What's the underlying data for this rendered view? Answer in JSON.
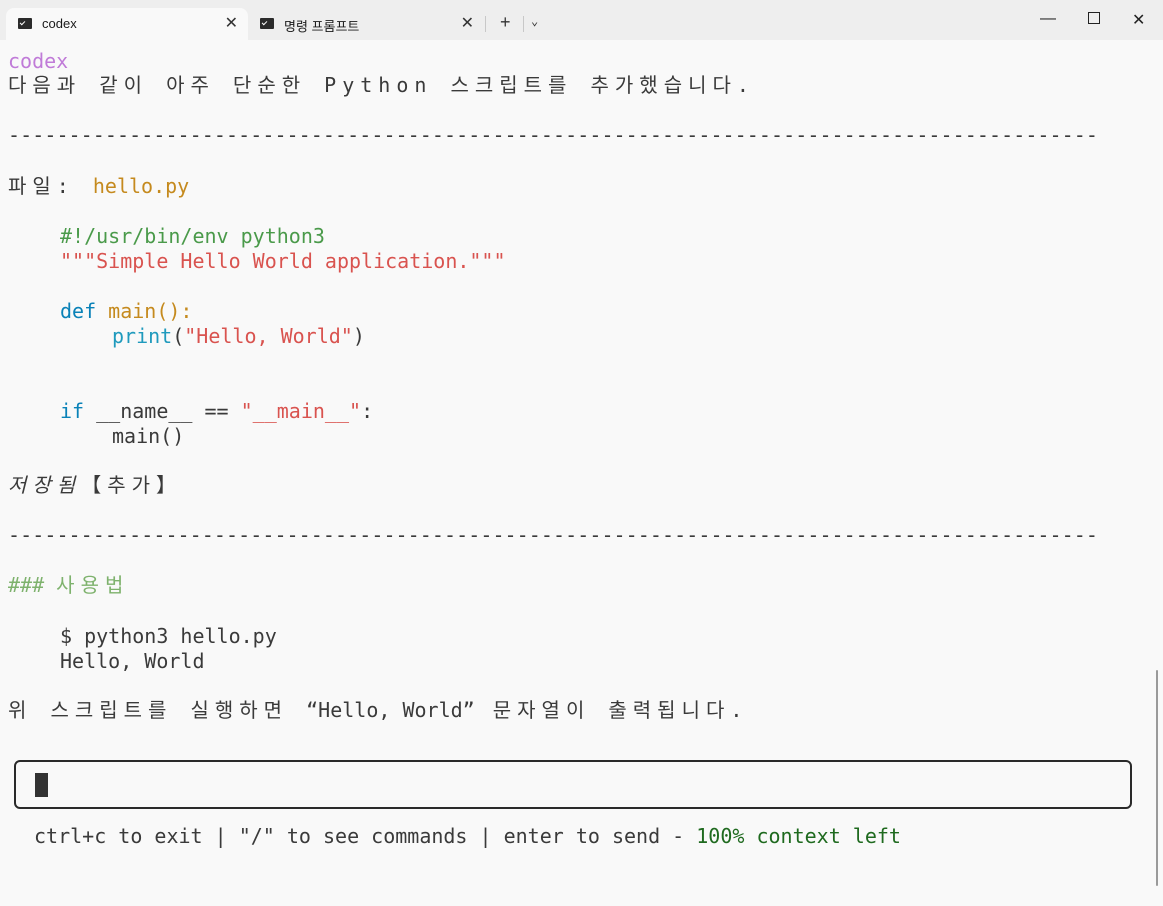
{
  "window": {
    "tabs": [
      {
        "label": "codex",
        "active": true
      },
      {
        "label": "명령 프롬프트",
        "active": false
      }
    ],
    "new_tab": "+",
    "tab_menu": "⌄",
    "controls": {
      "minimize": "—",
      "maximize": "",
      "close": "✕"
    }
  },
  "terminal": {
    "speaker": "codex",
    "intro": "다음과 같이 아주 단순한 Python 스크립트를 추가했습니다.",
    "separator": "------------------------------------------------------------------------------------------",
    "file_label": "파일: ",
    "file_name": "hello.py",
    "code": {
      "shebang": "#!/usr/bin/env python3",
      "docstring": "\"\"\"Simple Hello World application.\"\"\"",
      "def_kw": "def",
      "func_sig": " main():",
      "print_fn": "print",
      "paren_open": "(",
      "print_arg": "\"Hello, World\"",
      "paren_close": ")",
      "if_kw": "if",
      "if_cond": " __name__ == ",
      "main_str": "\"__main__\"",
      "colon": ":",
      "call": "main()"
    },
    "saved_label": "저장됨",
    "saved_tag": "【추가】",
    "usage_hashes": "### ",
    "usage_title": "사용법",
    "cmd": "$ python3 hello.py",
    "output": "Hello, World",
    "closing_pre": "위 스크립트를 실행하면 ",
    "closing_quote": "“Hello, World”",
    "closing_post": " 문자열이 출력됩니다."
  },
  "footer": {
    "help": "ctrl+c to exit | \"/\" to see commands | enter to send - ",
    "context": "100% context left"
  },
  "colors": {
    "purple": "#c07bd8",
    "orange": "#c58a1e",
    "green": "#4a9a4a",
    "red": "#d9534f",
    "blue": "#0a82b8"
  }
}
